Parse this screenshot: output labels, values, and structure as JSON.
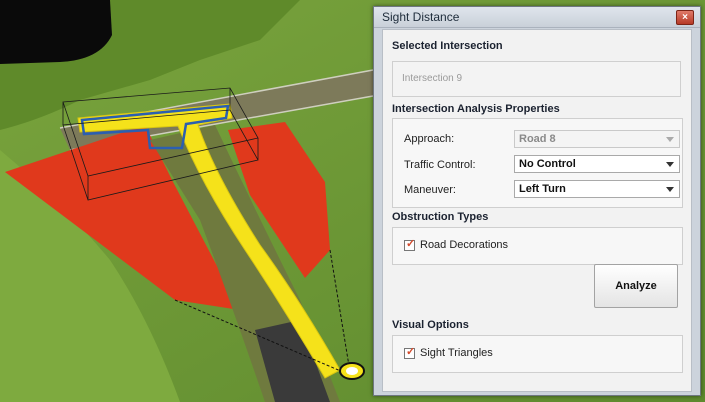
{
  "dialog": {
    "title": "Sight Distance",
    "close_label": "×"
  },
  "selected_intersection": {
    "heading": "Selected Intersection",
    "value": "Intersection 9"
  },
  "analysis_properties": {
    "heading": "Intersection Analysis Properties",
    "approach": {
      "label": "Approach:",
      "value": "Road 8",
      "enabled": false
    },
    "traffic_control": {
      "label": "Traffic Control:",
      "value": "No Control"
    },
    "maneuver": {
      "label": "Maneuver:",
      "value": "Left Turn"
    }
  },
  "obstruction_types": {
    "heading": "Obstruction Types",
    "road_decorations": {
      "label": "Road Decorations",
      "checked": true
    }
  },
  "analyze_button": {
    "label": "Analyze"
  },
  "visual_options": {
    "heading": "Visual Options",
    "sight_triangles": {
      "label": "Sight Triangles",
      "checked": true
    }
  },
  "colors": {
    "sight_triangle": "#e0391c",
    "highlight_road": "#f5e21a",
    "terrain": "#6f9a3a",
    "dialog_frame": "#ccd3dc"
  }
}
